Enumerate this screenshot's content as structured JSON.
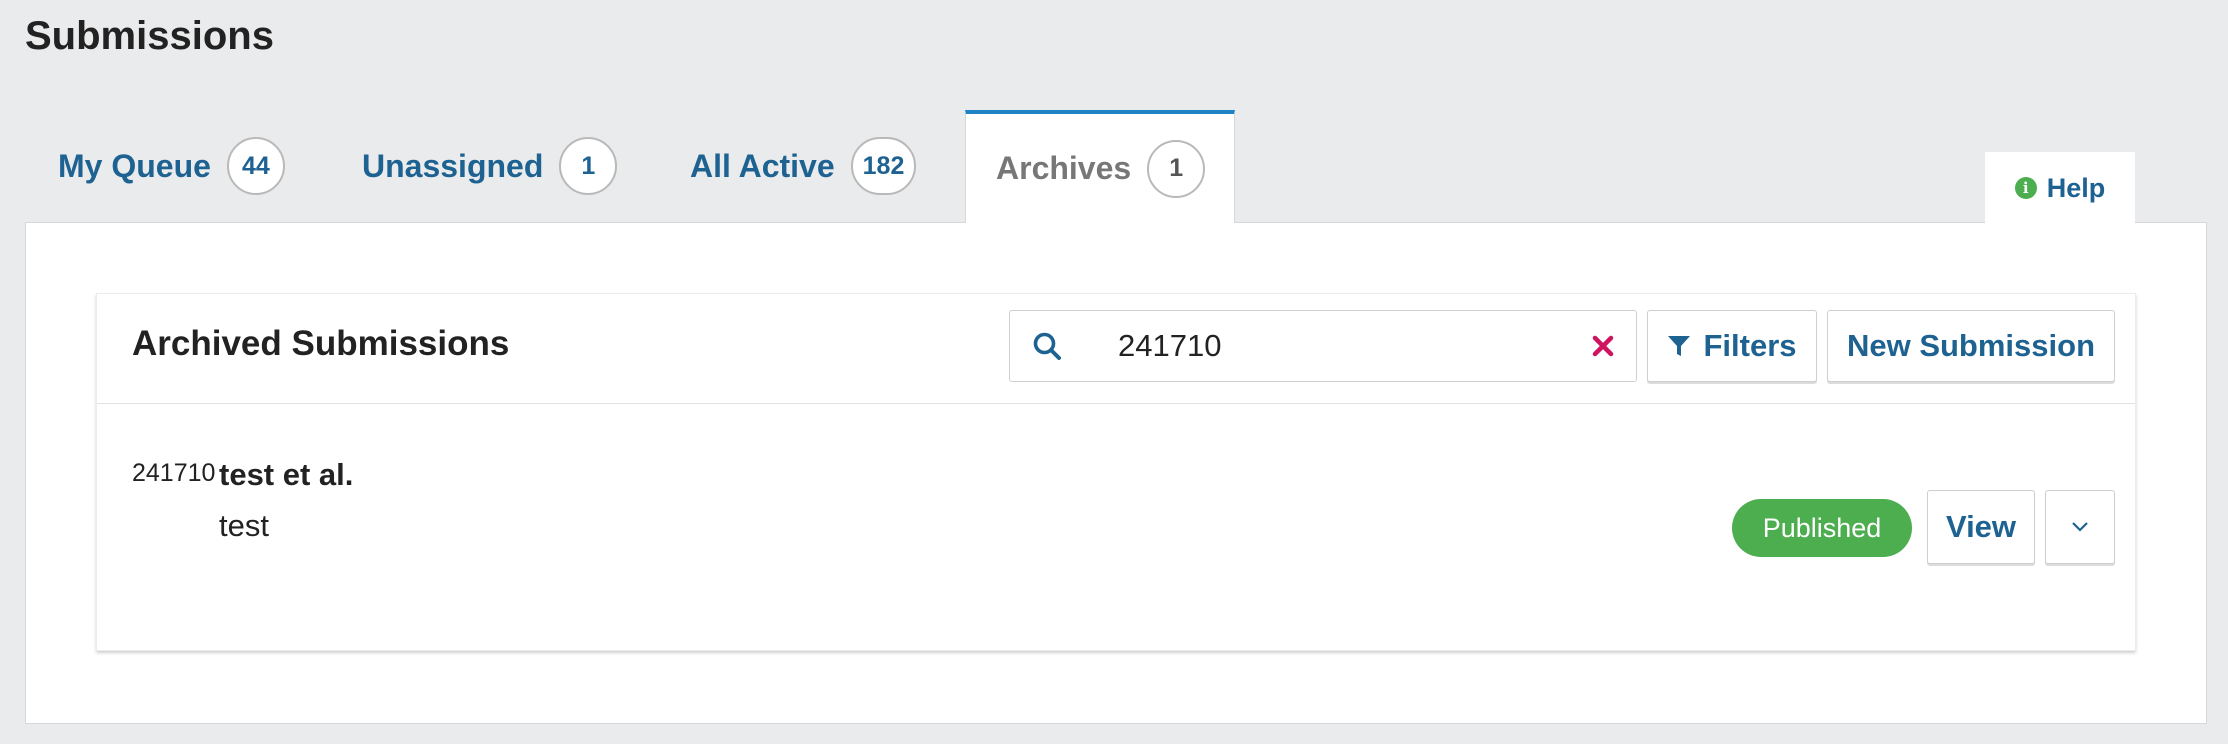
{
  "page": {
    "title": "Submissions"
  },
  "tabs": [
    {
      "label": "My Queue",
      "count": "44"
    },
    {
      "label": "Unassigned",
      "count": "1"
    },
    {
      "label": "All Active",
      "count": "182"
    },
    {
      "label": "Archives",
      "count": "1",
      "active": true
    }
  ],
  "help": {
    "label": "Help",
    "icon": "info-icon"
  },
  "card": {
    "title": "Archived Submissions",
    "search": {
      "value": "241710",
      "icon": "search-icon",
      "clear_icon": "close-icon"
    },
    "filters_label": "Filters",
    "new_submission_label": "New Submission"
  },
  "submissions": [
    {
      "id": "241710",
      "author": "test et al.",
      "title": "test",
      "status": "Published",
      "view_label": "View"
    }
  ],
  "colors": {
    "accent": "#1e6292",
    "active_tab_border": "#1e84c6",
    "status_published": "#4cae4f",
    "clear_icon": "#d0135e"
  }
}
